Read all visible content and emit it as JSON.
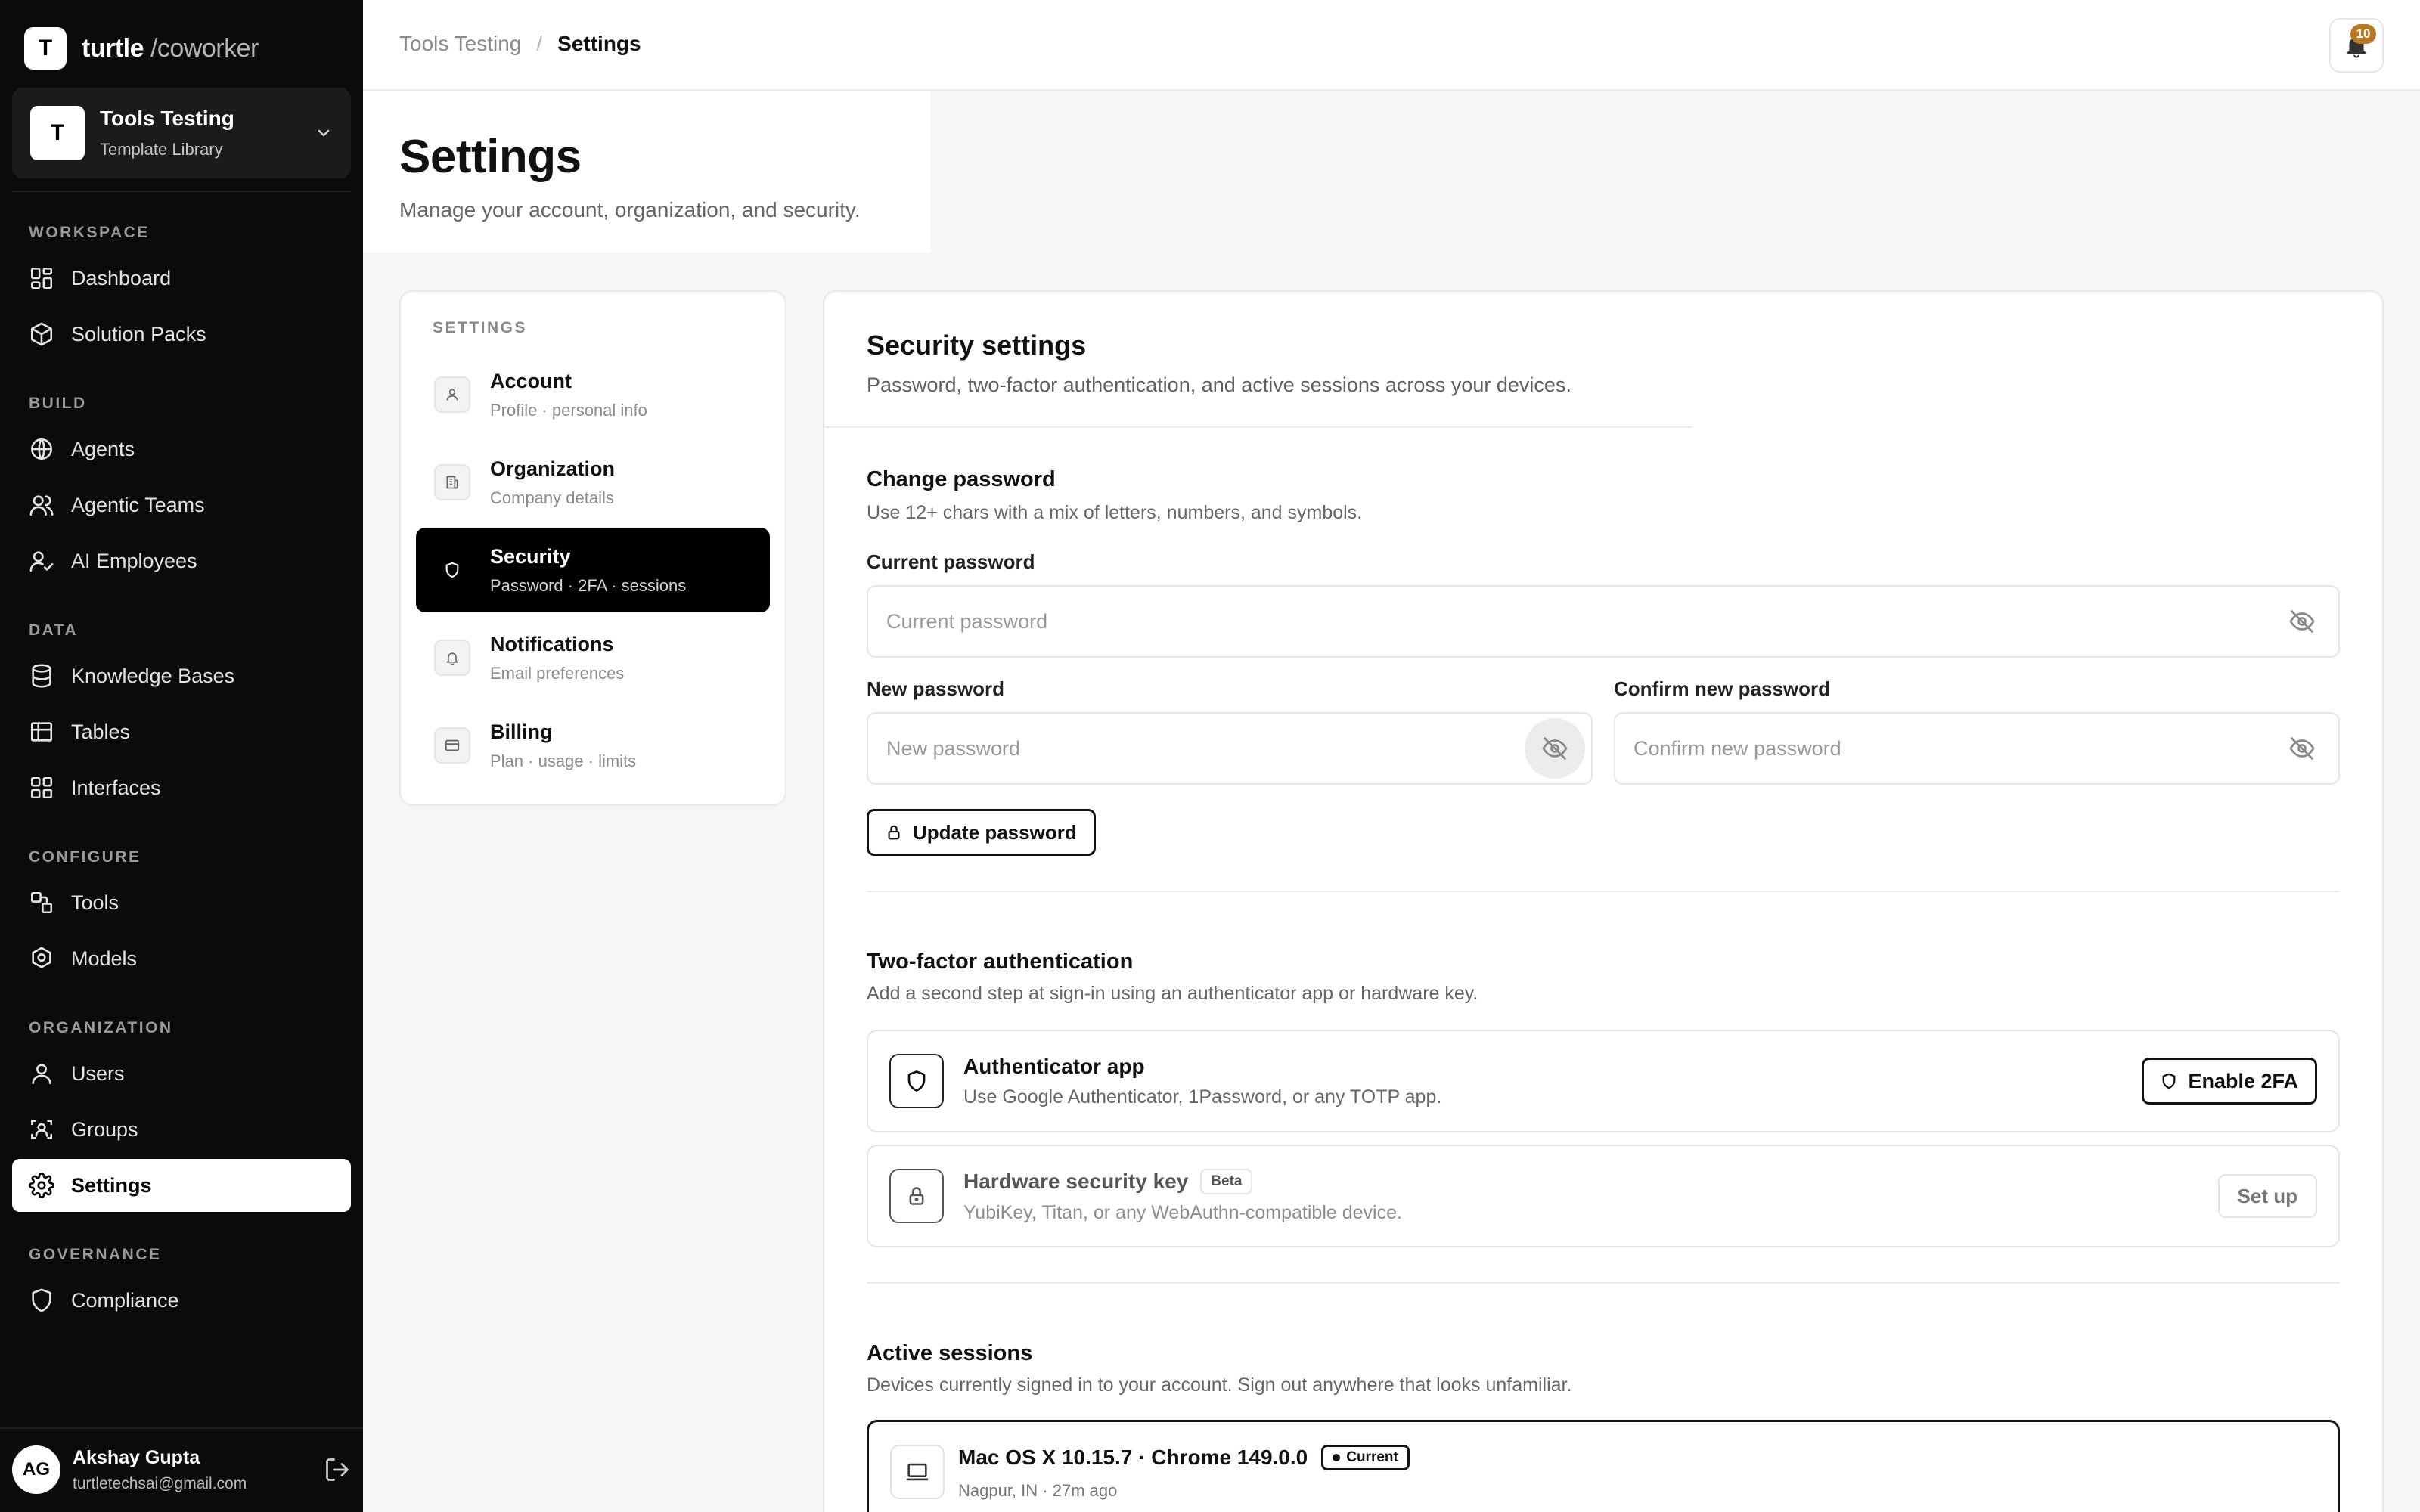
{
  "brand": {
    "mark": "T",
    "name": "turtle",
    "suffix": "/coworker"
  },
  "workspace": {
    "avatar": "T",
    "name": "Tools Testing",
    "subtitle": "Template Library"
  },
  "sidebar": {
    "sections": [
      "WORKSPACE",
      "BUILD",
      "DATA",
      "CONFIGURE",
      "ORGANIZATION",
      "GOVERNANCE"
    ],
    "items": [
      {
        "label": "Dashboard",
        "icon": "dashboard-icon"
      },
      {
        "label": "Solution Packs",
        "icon": "package-icon"
      },
      {
        "label": "Agents",
        "icon": "globe-icon"
      },
      {
        "label": "Agentic Teams",
        "icon": "team-icon"
      },
      {
        "label": "AI Employees",
        "icon": "user-check-icon"
      },
      {
        "label": "Knowledge Bases",
        "icon": "database-icon"
      },
      {
        "label": "Tables",
        "icon": "table-icon"
      },
      {
        "label": "Interfaces",
        "icon": "layout-icon"
      },
      {
        "label": "Tools",
        "icon": "tools-icon"
      },
      {
        "label": "Models",
        "icon": "models-icon"
      },
      {
        "label": "Users",
        "icon": "user-icon"
      },
      {
        "label": "Groups",
        "icon": "groups-icon"
      },
      {
        "label": "Settings",
        "icon": "gear-icon",
        "active": true
      },
      {
        "label": "Compliance",
        "icon": "shield-icon"
      }
    ]
  },
  "user": {
    "initials": "AG",
    "name": "Akshay Gupta",
    "email": "turtletechsai@gmail.com"
  },
  "topbar": {
    "breadcrumb": [
      "Tools Testing",
      "Settings"
    ],
    "separator": "/",
    "notification_count": "10"
  },
  "header": {
    "title": "Settings",
    "subtitle": "Manage your account, organization, and security."
  },
  "settings_nav": {
    "title": "SETTINGS",
    "items": [
      {
        "label": "Account",
        "desc": "Profile · personal info",
        "icon": "user-icon"
      },
      {
        "label": "Organization",
        "desc": "Company details",
        "icon": "building-icon"
      },
      {
        "label": "Security",
        "desc": "Password · 2FA · sessions",
        "icon": "shield-icon",
        "active": true
      },
      {
        "label": "Notifications",
        "desc": "Email preferences",
        "icon": "bell-icon"
      },
      {
        "label": "Billing",
        "desc": "Plan · usage · limits",
        "icon": "credit-card-icon"
      }
    ]
  },
  "security": {
    "title": "Security settings",
    "subtitle": "Password, two-factor authentication, and active sessions across your devices.",
    "password": {
      "title": "Change password",
      "hint": "Use 12+ chars with a mix of letters, numbers, and symbols.",
      "current_label": "Current password",
      "current_placeholder": "Current password",
      "new_label": "New password",
      "new_placeholder": "New password",
      "confirm_label": "Confirm new password",
      "confirm_placeholder": "Confirm new password",
      "update_button": "Update password"
    },
    "twofa": {
      "title": "Two-factor authentication",
      "hint": "Add a second step at sign-in using an authenticator app or hardware key.",
      "app_title": "Authenticator app",
      "app_desc": "Use Google Authenticator, 1Password, or any TOTP app.",
      "enable_button": "Enable 2FA",
      "key_title": "Hardware security key",
      "key_badge": "Beta",
      "key_desc": "YubiKey, Titan, or any WebAuthn-compatible device.",
      "setup_button": "Set up"
    },
    "sessions": {
      "title": "Active sessions",
      "hint": "Devices currently signed in to your account. Sign out anywhere that looks unfamiliar.",
      "items": [
        {
          "device": "Mac OS X 10.15.7 · Chrome 149.0.0",
          "badge": "Current",
          "meta": "Nagpur, IN · 27m ago"
        }
      ]
    }
  }
}
